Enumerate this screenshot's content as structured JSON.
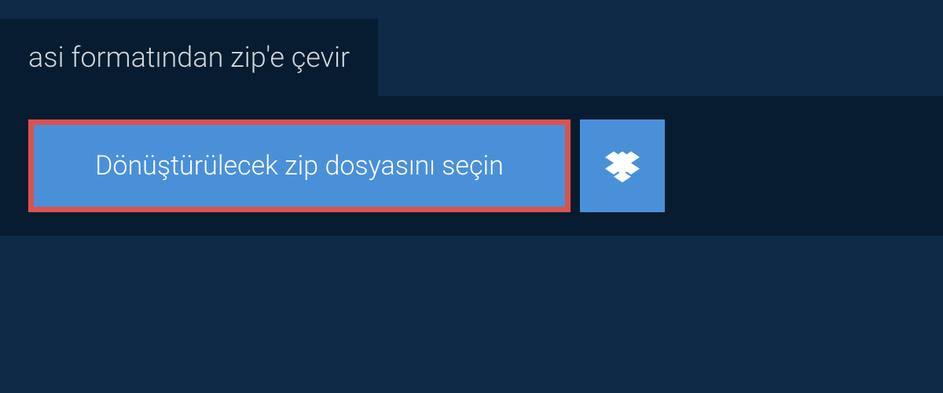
{
  "header": {
    "title": "asi formatından zip'e çevir"
  },
  "upload": {
    "select_file_label": "Dönüştürülecek zip dosyasını seçin"
  },
  "colors": {
    "background": "#0e2a47",
    "panel": "#071c30",
    "button": "#4a90d9",
    "button_border": "#d9534f",
    "text_light": "#ffffff",
    "text_muted": "#d0d5db"
  }
}
